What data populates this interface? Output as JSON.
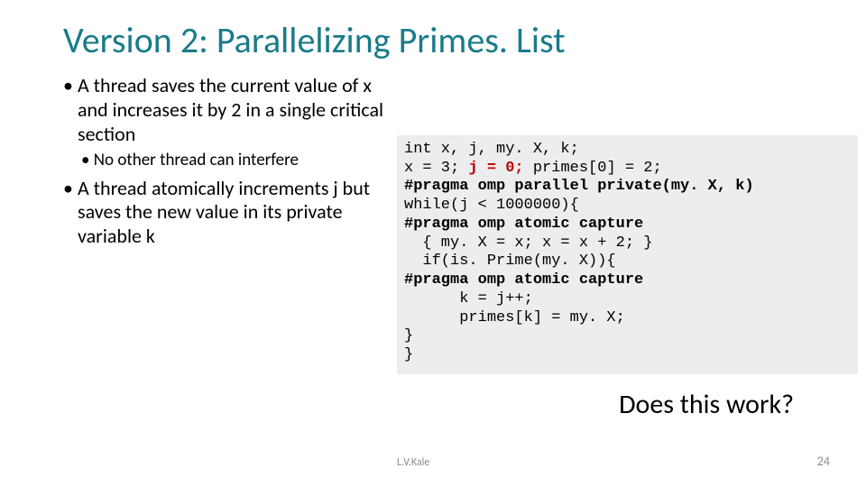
{
  "title": "Version 2: Parallelizing Primes. List",
  "bullets": {
    "b1a": "A thread saves the current value of x and increases it by 2 in a single critical section",
    "b2a": "No other thread can interfere",
    "b1b": "A thread atomically increments j but saves the new value in its private variable k"
  },
  "code": {
    "l1_a": "int x, j, my. X, k;",
    "l2_a": "x = 3; ",
    "l2_b": "j = 0;",
    "l2_c": " primes[0] = 2;",
    "l3": "#pragma omp parallel private(my. X, k)",
    "l4": "while(j < 1000000){",
    "l5": "#pragma omp atomic capture",
    "l6": "  { my. X = x; x = x + 2; }",
    "l7": "  if(is. Prime(my. X)){",
    "l8": "#pragma omp atomic capture",
    "l9": "      k = j++;",
    "l10": "      primes[k] = my. X;",
    "l11": "}",
    "l12": "}"
  },
  "question": "Does this work?",
  "footer_left": "L.V.Kale",
  "footer_right": "24"
}
